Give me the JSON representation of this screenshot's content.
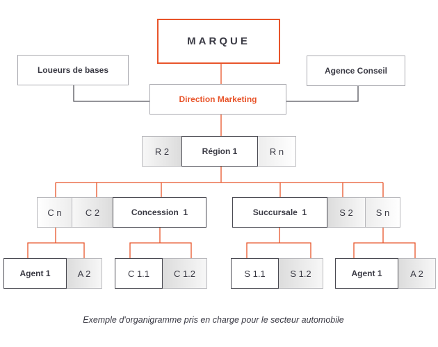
{
  "colors": {
    "accent": "#e8542a",
    "line_gray": "#55555c",
    "text": "#3a3a44"
  },
  "top": {
    "brand": "MARQUE",
    "left_partner": "Loueurs de bases",
    "right_partner": "Agence Conseil",
    "direction": "Direction Marketing"
  },
  "region": {
    "main": "Région 1",
    "left": "R 2",
    "right": "R n"
  },
  "left_branch": {
    "main": "Concession  1",
    "second": "C 2",
    "nth": "C n"
  },
  "right_branch": {
    "main": "Succursale  1",
    "second": "S 2",
    "nth": "S n"
  },
  "bottom": {
    "agents_left": {
      "main": "Agent 1",
      "second": "A 2"
    },
    "concession_sub": {
      "main": "C 1.1",
      "second": "C 1.2"
    },
    "succursale_sub": {
      "main": "S 1.1",
      "second": "S 1.2"
    },
    "agents_right": {
      "main": "Agent 1",
      "second": "A 2"
    }
  },
  "caption": "Exemple d'organigramme pris en charge pour le secteur automobile"
}
